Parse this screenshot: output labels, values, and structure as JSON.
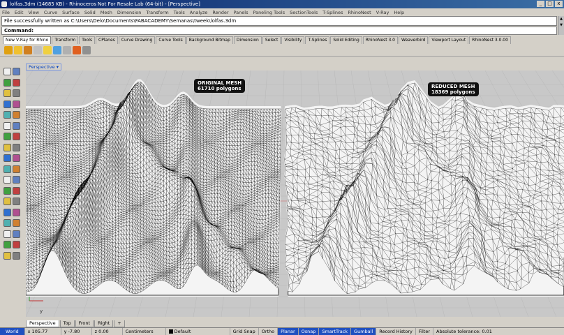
{
  "window": {
    "title": "lolfas.3dm (14685 KB) - Rhinoceros Not For Resale Lab (64-bit) - [Perspective]",
    "min": "_",
    "max": "□",
    "close": "x"
  },
  "menu": [
    "File",
    "Edit",
    "View",
    "Curve",
    "Surface",
    "Solid",
    "Mesh",
    "Dimension",
    "Transform",
    "Tools",
    "Analyze",
    "Render",
    "Panels",
    "Paneling Tools",
    "SectionTools",
    "T-Splines",
    "RhinoNest",
    "V-Ray",
    "Help"
  ],
  "command_history": "File successfully written as C:\\Users\\Delo\\Documents\\FABACADEMY\\Semanas\\tweek\\lolfas.3dm",
  "command_prompt": "Command:",
  "toolbar_tabs": [
    "New V-Ray for Rhino",
    "Transform",
    "Tools",
    "CPlanes",
    "Curve Drawing",
    "Curve Tools",
    "Background Bitmap",
    "Dimension",
    "Select",
    "Visibility",
    "T-Splines",
    "Solid Editing",
    "RhinoNest 3.0",
    "Weaverbird",
    "Viewport Layout",
    "RhinoNest 3.0.00"
  ],
  "viewport": {
    "name": "Perspective",
    "menu_arrow": "▾",
    "labels": {
      "original": {
        "line1": "ORIGINAL MESH",
        "line2": "61710 polygons"
      },
      "reduced": {
        "line1": "REDUCED MESH",
        "line2": "18369 polygons"
      }
    },
    "axis_label": "y"
  },
  "view_tabs": [
    "Perspective",
    "Top",
    "Front",
    "Right",
    "+"
  ],
  "status": {
    "cplane": "World",
    "x": "x 105.77",
    "y": "y -7.80",
    "z": "z 0.00",
    "units": "Centimeters",
    "layer": "Default",
    "grid_snap": "Grid Snap",
    "ortho": "Ortho",
    "planar": "Planar",
    "osnap": "Osnap",
    "smarttrack": "SmartTrack",
    "gumball": "Gumball",
    "record_history": "Record History",
    "filter": "Filter",
    "tolerance": "Absolute tolerance: 0.01"
  },
  "colors": {
    "title_bar": "#0a246a",
    "viewport_bg": "#c8c8c8",
    "mesh_line": "#000000",
    "active_status": "#2050c0"
  }
}
